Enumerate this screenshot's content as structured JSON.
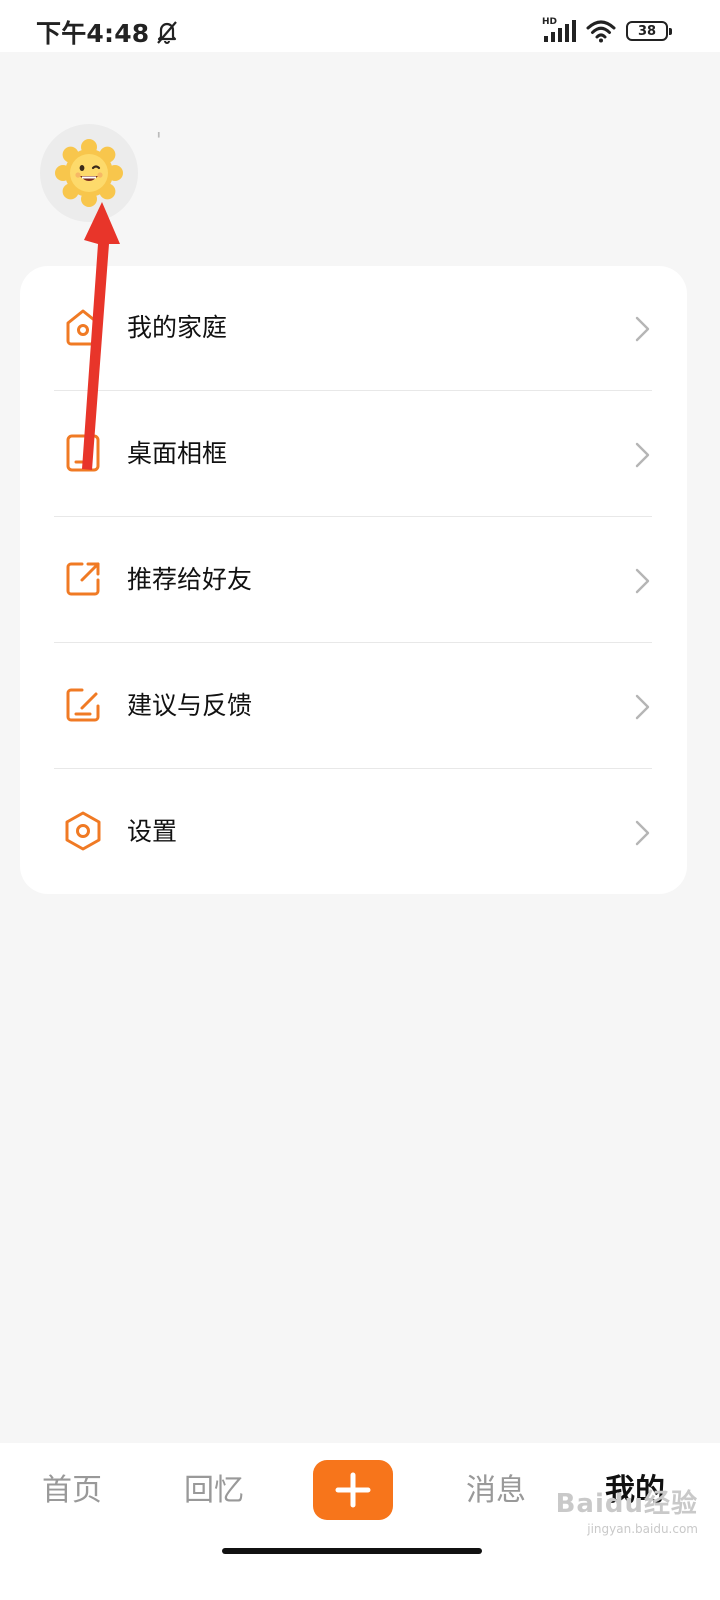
{
  "status_bar": {
    "time": "下午4:48",
    "network": "HD",
    "battery": "38",
    "icons": [
      "mute-bell-icon",
      "signal-icon",
      "wifi-icon",
      "battery-icon"
    ]
  },
  "profile": {
    "avatar_icon": "sun-face-icon",
    "name": "'"
  },
  "menu": {
    "items": [
      {
        "label": "我的家庭",
        "icon": "home-icon"
      },
      {
        "label": "桌面相框",
        "icon": "photo-frame-icon"
      },
      {
        "label": "推荐给好友",
        "icon": "share-icon"
      },
      {
        "label": "建议与反馈",
        "icon": "feedback-edit-icon"
      },
      {
        "label": "设置",
        "icon": "settings-hexagon-icon"
      }
    ]
  },
  "bottom_nav": {
    "items": [
      {
        "label": "首页"
      },
      {
        "label": "回忆"
      },
      {
        "label": "消息"
      },
      {
        "label": "我的"
      }
    ],
    "active": "我的",
    "add_icon": "plus-icon"
  },
  "watermark": {
    "main": "Baidu经验",
    "sub": "jingyan.baidu.com"
  },
  "colors": {
    "accent": "#f7751b",
    "background": "#f6f6f6",
    "card": "#ffffff",
    "annotation": "#e8352a"
  }
}
